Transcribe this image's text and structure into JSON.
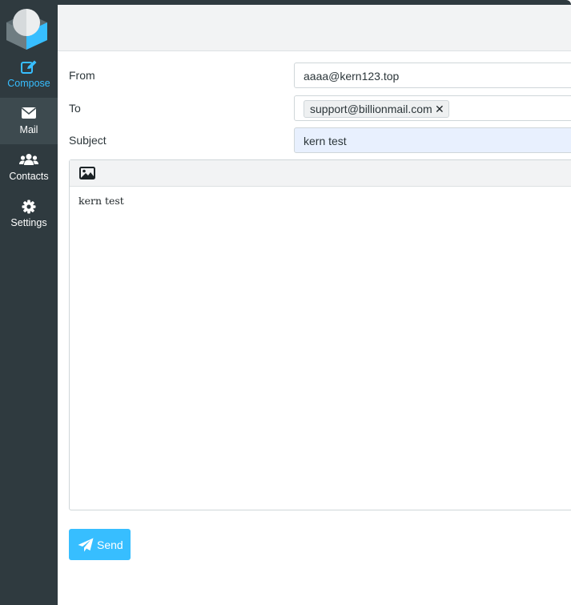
{
  "sidebar": {
    "items": [
      {
        "label": "Compose",
        "icon": "compose-icon",
        "active": false
      },
      {
        "label": "Mail",
        "icon": "envelope-icon",
        "active": true
      },
      {
        "label": "Contacts",
        "icon": "contacts-icon",
        "active": false
      },
      {
        "label": "Settings",
        "icon": "gear-icon",
        "active": false
      }
    ]
  },
  "form": {
    "from_label": "From",
    "from_value": "aaaa@kern123.top",
    "to_label": "To",
    "to_recipients": [
      "support@billionmail.com"
    ],
    "subject_label": "Subject",
    "subject_value": "kern test"
  },
  "editor": {
    "toolbar_icon": "image-icon",
    "body": "kern test"
  },
  "actions": {
    "send_label": "Send",
    "send_icon": "paper-plane-icon"
  },
  "colors": {
    "sidebar_bg": "#2f3a3f",
    "accent": "#37beff",
    "subject_bg": "#e8f0fe"
  }
}
